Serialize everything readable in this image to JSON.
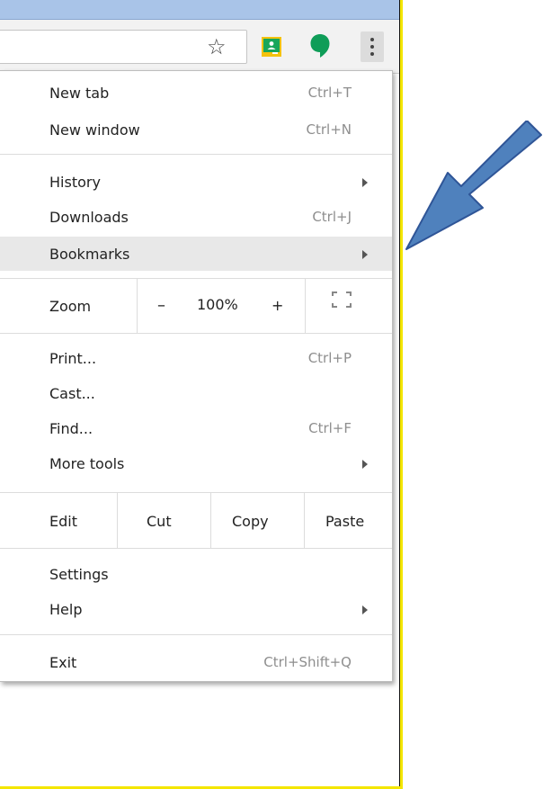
{
  "colors": {
    "titlebar": "#a9c4e8",
    "toolbar": "#f2f2f2",
    "frame_border": "#f4e600",
    "classroom_green": "#18a65a",
    "hangouts_green": "#0f9d58",
    "arrow_fill": "#4f81bd",
    "arrow_stroke": "#2f5597",
    "highlight": "#e8e8e8"
  },
  "toolbar": {
    "icons": [
      "star-icon",
      "google-classroom-icon",
      "hangouts-icon",
      "more-options-icon"
    ]
  },
  "menu": {
    "new_tab": {
      "label": "New tab",
      "shortcut": "Ctrl+T"
    },
    "new_window": {
      "label": "New window",
      "shortcut": "Ctrl+N"
    },
    "history": {
      "label": "History"
    },
    "downloads": {
      "label": "Downloads",
      "shortcut": "Ctrl+J"
    },
    "bookmarks": {
      "label": "Bookmarks"
    },
    "zoom": {
      "label": "Zoom",
      "minus": "–",
      "level": "100%",
      "plus": "+"
    },
    "print": {
      "label": "Print...",
      "shortcut": "Ctrl+P"
    },
    "cast": {
      "label": "Cast..."
    },
    "find": {
      "label": "Find...",
      "shortcut": "Ctrl+F"
    },
    "more_tools": {
      "label": "More tools"
    },
    "edit": {
      "label": "Edit",
      "cut": "Cut",
      "copy": "Copy",
      "paste": "Paste"
    },
    "settings": {
      "label": "Settings"
    },
    "help": {
      "label": "Help"
    },
    "exit": {
      "label": "Exit",
      "shortcut": "Ctrl+Shift+Q"
    }
  }
}
